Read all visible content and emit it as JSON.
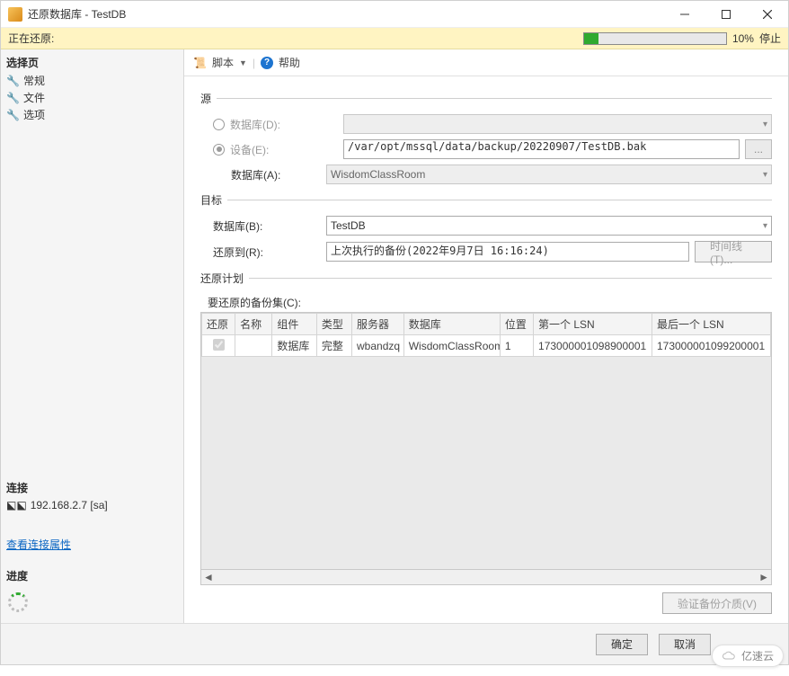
{
  "window": {
    "title": "还原数据库 - TestDB"
  },
  "progress": {
    "label": "正在还原:",
    "percent_text": "10%",
    "stop_label": "停止"
  },
  "sidebar": {
    "select_page_title": "选择页",
    "items": [
      {
        "label": "常规"
      },
      {
        "label": "文件"
      },
      {
        "label": "选项"
      }
    ],
    "connection_title": "连接",
    "connection_value": "192.168.2.7 [sa]",
    "view_props_link": "查看连接属性",
    "progress_title": "进度"
  },
  "toolbar": {
    "script_label": "脚本",
    "help_label": "帮助"
  },
  "groups": {
    "source": "源",
    "target": "目标",
    "plan": "还原计划"
  },
  "source": {
    "radio_database_label": "数据库(D):",
    "radio_device_label": "设备(E):",
    "device_path": "/var/opt/mssql/data/backup/20220907/TestDB.bak",
    "database_label": "数据库(A):",
    "database_value": "WisdomClassRoom",
    "browse_label": "..."
  },
  "target": {
    "database_label": "数据库(B):",
    "database_value": "TestDB",
    "restore_to_label": "还原到(R):",
    "restore_to_value": "上次执行的备份(2022年9月7日 16:16:24)",
    "timeline_label": "时间线(T)..."
  },
  "plan": {
    "sets_label": "要还原的备份集(C):",
    "headers": {
      "restore": "还原",
      "name": "名称",
      "component": "组件",
      "type": "类型",
      "server": "服务器",
      "database": "数据库",
      "position": "位置",
      "first_lsn": "第一个 LSN",
      "last_lsn": "最后一个 LSN"
    },
    "rows": [
      {
        "restore_checked": true,
        "name": "",
        "component": "数据库",
        "type": "完整",
        "server": "wbandzq",
        "database": "WisdomClassRoom",
        "position": "1",
        "first_lsn": "173000001098900001",
        "last_lsn": "173000001099200001"
      }
    ],
    "verify_label": "验证备份介质(V)"
  },
  "footer": {
    "ok": "确定",
    "cancel": "取消"
  },
  "badge": {
    "text": "亿速云"
  }
}
